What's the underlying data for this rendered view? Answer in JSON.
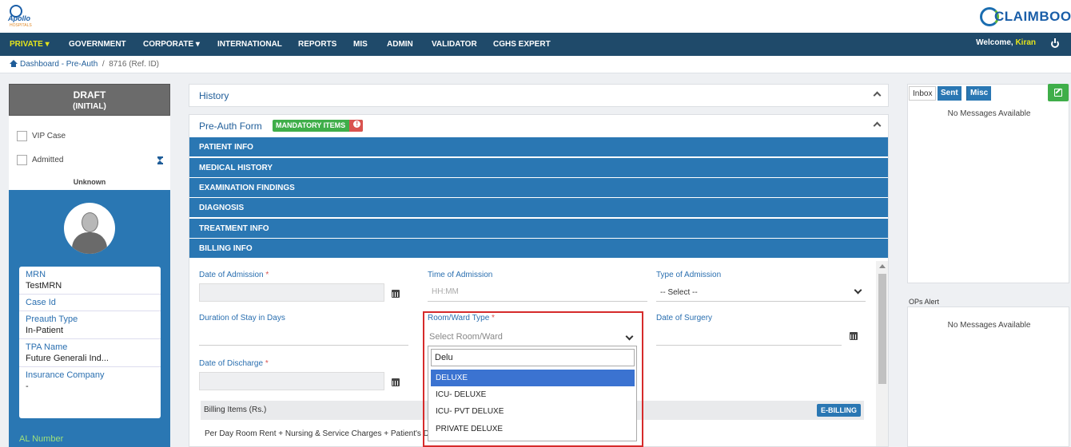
{
  "header": {
    "apollo_logo_text": "Apollo",
    "apollo_logo_sub": "HOSPITALS",
    "claimbook_logo_text": "CLAIMBOOK"
  },
  "nav": {
    "items": [
      {
        "label": "PRIVATE ▾"
      },
      {
        "label": "GOVERNMENT"
      },
      {
        "label": "CORPORATE ▾"
      },
      {
        "label": "INTERNATIONAL"
      },
      {
        "label": "REPORTS"
      },
      {
        "label": "MIS"
      },
      {
        "label": "ADMIN"
      },
      {
        "label": "VALIDATOR"
      },
      {
        "label": "CGHS EXPERT"
      }
    ],
    "welcome_label": "Welcome,",
    "user_name": "Kiran"
  },
  "breadcrumb": {
    "home_label": "Dashboard - Pre-Auth",
    "separator": "/",
    "ref": "8716  (Ref. ID)"
  },
  "left": {
    "status_title": "DRAFT",
    "status_sub": "(INITIAL)",
    "vip_label": "VIP Case",
    "admitted_label": "Admitted",
    "unknown_label": "Unknown",
    "fields": [
      {
        "label": "MRN",
        "value": "TestMRN"
      },
      {
        "label": "Case Id",
        "value": ""
      },
      {
        "label": "Preauth Type",
        "value": "In-Patient"
      },
      {
        "label": "TPA Name",
        "value": "Future Generali Ind..."
      },
      {
        "label": "Insurance Company",
        "value": "-"
      }
    ],
    "al_number_label": "AL Number"
  },
  "center": {
    "history_title": "History",
    "form_title": "Pre-Auth Form",
    "mandatory_badge": "MANDATORY ITEMS",
    "sections": [
      {
        "label": "PATIENT INFO"
      },
      {
        "label": "MEDICAL HISTORY"
      },
      {
        "label": "EXAMINATION FINDINGS"
      },
      {
        "label": "DIAGNOSIS"
      },
      {
        "label": "TREATMENT INFO"
      },
      {
        "label": "BILLING INFO"
      }
    ],
    "billing": {
      "date_of_admission_label": "Date of Admission",
      "time_of_admission_label": "Time of Admission",
      "time_placeholder": "HH:MM",
      "type_of_admission_label": "Type of Admission",
      "type_of_admission_value": "-- Select --",
      "duration_label": "Duration of Stay in Days",
      "room_ward_label": "Room/Ward Type",
      "room_ward_placeholder": "Select Room/Ward",
      "date_of_surgery_label": "Date of Surgery",
      "date_of_discharge_label": "Date of Discharge",
      "required_mark": "*",
      "billing_items_label": "Billing Items (Rs.)",
      "ebilling_button": "E-BILLING",
      "billing_row_text": "Per Day Room Rent + Nursing & Service Charges + Patient's D"
    },
    "dropdown": {
      "search_value": "Delu",
      "options": [
        {
          "label": "DELUXE",
          "active": true
        },
        {
          "label": "ICU- DELUXE",
          "active": false
        },
        {
          "label": "ICU- PVT DELUXE",
          "active": false
        },
        {
          "label": "PRIVATE DELUXE",
          "active": false
        }
      ]
    }
  },
  "right": {
    "tabs": [
      {
        "label": "Inbox"
      },
      {
        "label": "Sent"
      },
      {
        "label": "Misc"
      }
    ],
    "inbox_empty": "No Messages Available",
    "ops_alert_label": "OPs Alert",
    "ops_empty": "No Messages Available"
  },
  "colors": {
    "navbar": "#1f4a6a",
    "section_bar": "#2a77b3",
    "accent_yellow": "#e3e31d",
    "mandatory_green": "#3fae49",
    "highlight_red": "#d62b2b",
    "option_active": "#3b73d1"
  }
}
